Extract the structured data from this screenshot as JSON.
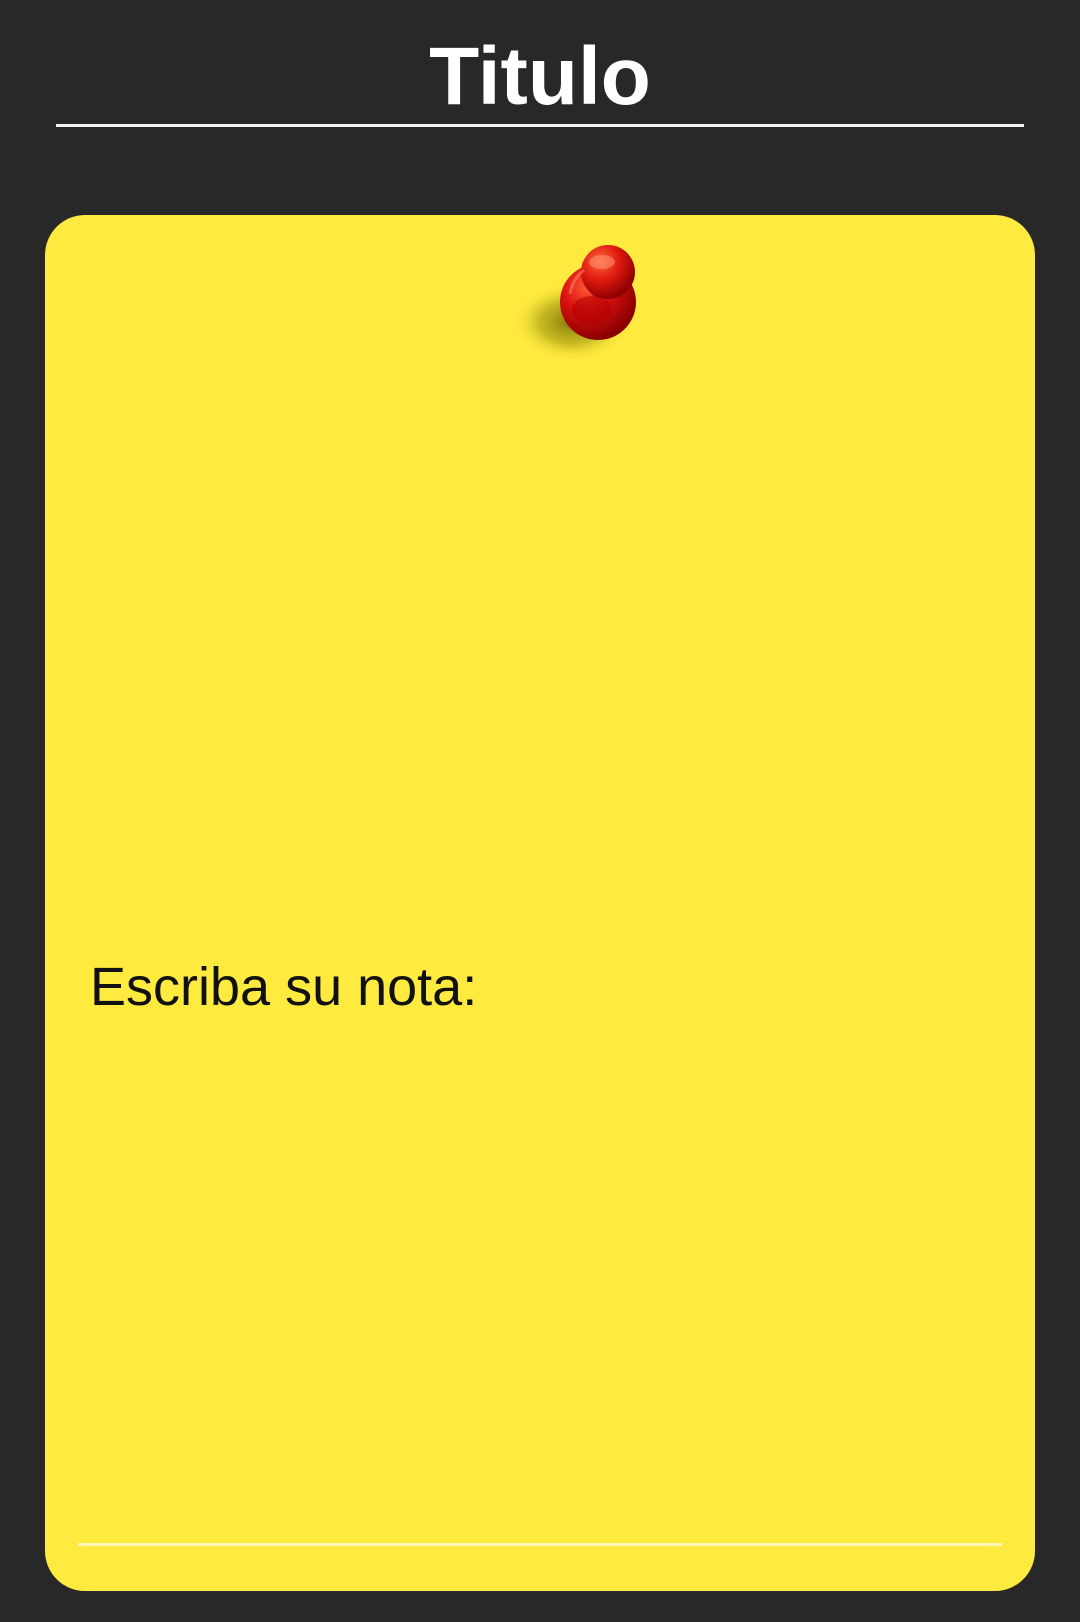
{
  "header": {
    "title": "Titulo"
  },
  "note": {
    "label": "Escriba su nota:",
    "input_value": "",
    "pin_icon": "pushpin-icon"
  },
  "colors": {
    "background": "#282828",
    "note": "#ffeb3f",
    "pin": "#d40d0d",
    "text_light": "#ffffff",
    "text_dark": "#111111"
  }
}
